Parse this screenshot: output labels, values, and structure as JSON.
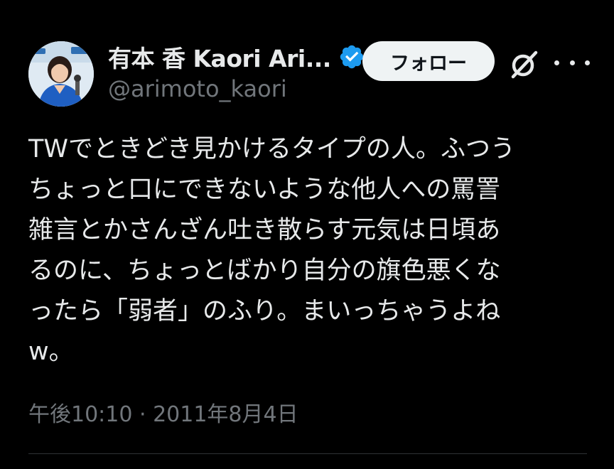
{
  "author": {
    "display_name": "有本 香 Kaori Ari...",
    "handle": "@arimoto_kaori",
    "verified": true
  },
  "actions": {
    "follow_label": "フォロー",
    "grok_icon": "grok-slash-icon",
    "more_icon": "more-horizontal-icon"
  },
  "tweet": {
    "lines": [
      "TWでときどき見かけるタイプの人。ふつう",
      "ちょっと口にできないような他人への罵詈",
      "雑言とかさんざん吐き散らす元気は日頃あ",
      "るのに、ちょっとばかり自分の旗色悪くな",
      "ったら「弱者」のふり。まいっちゃうよね",
      "w。"
    ]
  },
  "timestamp": "午後10:10 · 2011年8月4日",
  "colors": {
    "background": "#000000",
    "text_primary": "#e7e9ea",
    "text_secondary": "#71767b",
    "verified_blue": "#1d9bf0",
    "follow_bg": "#eff3f4",
    "divider": "#2f3336"
  }
}
